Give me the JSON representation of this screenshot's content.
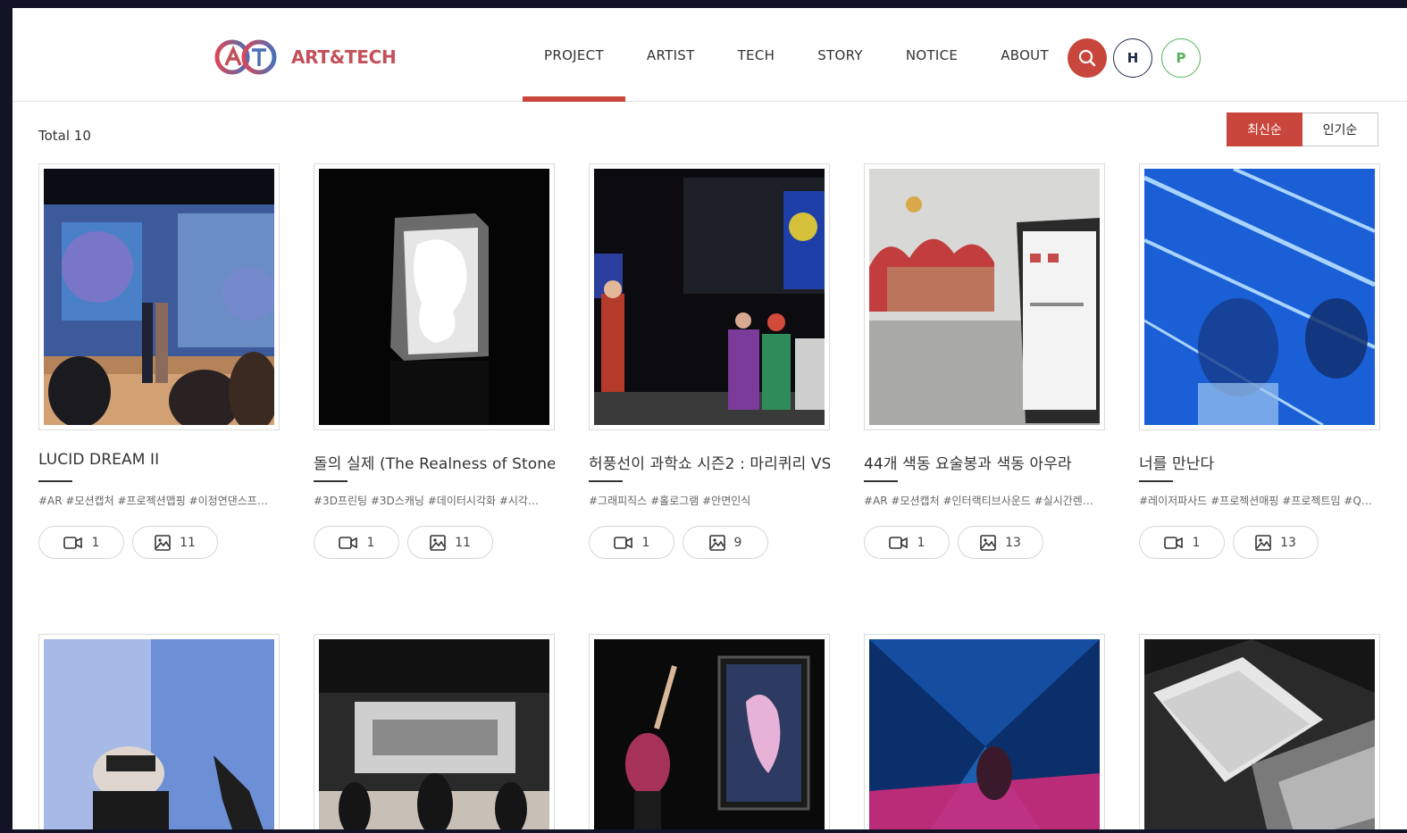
{
  "header": {
    "logo_text": "ART&TECH",
    "nav": [
      "PROJECT",
      "ARTIST",
      "TECH",
      "STORY",
      "NOTICE",
      "ABOUT"
    ],
    "active_nav": "PROJECT",
    "search_color": "#c8463c",
    "h_label": "H",
    "p_label": "P"
  },
  "toolbar": {
    "total": "Total 10",
    "sort_latest": "최신순",
    "sort_popular": "인기순"
  },
  "colors": {
    "accent": "#c8463c",
    "navy": "#1e2a4a",
    "green": "#55b35a"
  },
  "projects": [
    {
      "title": "LUCID DREAM II",
      "tags": "#AR #모션캡처 #프로젝션맵핑 #이정연댄스프로...",
      "videos": "1",
      "images": "11"
    },
    {
      "title": "돌의 실제 (The Realness of Stone)",
      "tags": "#3D프린팅 #3D스캐닝 #데이터시각화 #시각신호...",
      "videos": "1",
      "images": "11"
    },
    {
      "title": "허풍선이 과학쇼 시즌2 : 마리퀴리 VS",
      "tags": "#그래피직스 #홀로그램 #안면인식",
      "videos": "1",
      "images": "9"
    },
    {
      "title": "44개 색동 요술봉과 색동 아우라",
      "tags": "#AR #모션캡처 #인터랙티브사운드 #실시간렌더 ...",
      "videos": "1",
      "images": "13"
    },
    {
      "title": "너를 만난다",
      "tags": "#레이저파사드 #프로젝션매핑 #프로젝트밈 #QR...",
      "videos": "1",
      "images": "13"
    }
  ]
}
